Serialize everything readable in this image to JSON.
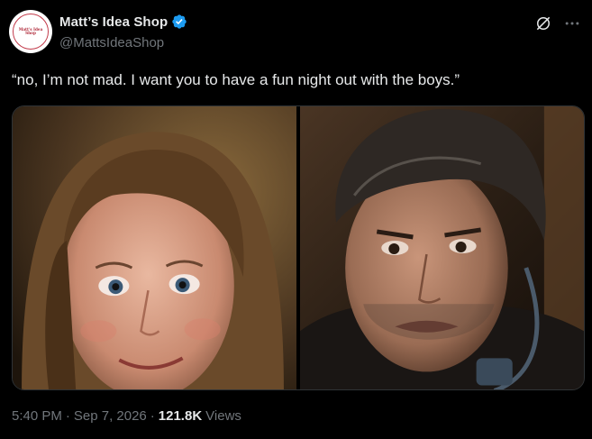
{
  "author": {
    "display_name": "Matt’s Idea Shop",
    "handle": "@MattsIdeaShop",
    "verified": true,
    "avatar_text": "Matt's Idea Shop",
    "avatar_accent": "#c23a4a"
  },
  "actions": {
    "grok_icon": "grok-slash-circle-icon",
    "more_icon": "more-dots-icon"
  },
  "tweet": {
    "text": "“no, I’m not mad. I want you to have a fun night out with the boys.”"
  },
  "media": {
    "images": [
      {
        "subject": "woman-closeup",
        "palette": [
          "#3a2a18",
          "#7a5a34",
          "#d9a48a"
        ]
      },
      {
        "subject": "man-closeup",
        "palette": [
          "#2a1e14",
          "#4a3a2c",
          "#b98a6c"
        ]
      }
    ]
  },
  "meta": {
    "time": "5:40 PM",
    "date": "Sep 7, 2026",
    "views_count": "121.8K",
    "views_label": "Views"
  },
  "colors": {
    "background": "#000000",
    "primary_text": "#e7e9ea",
    "secondary_text": "#71767b",
    "verified_blue": "#1d9bf0",
    "border": "#2f3336"
  }
}
